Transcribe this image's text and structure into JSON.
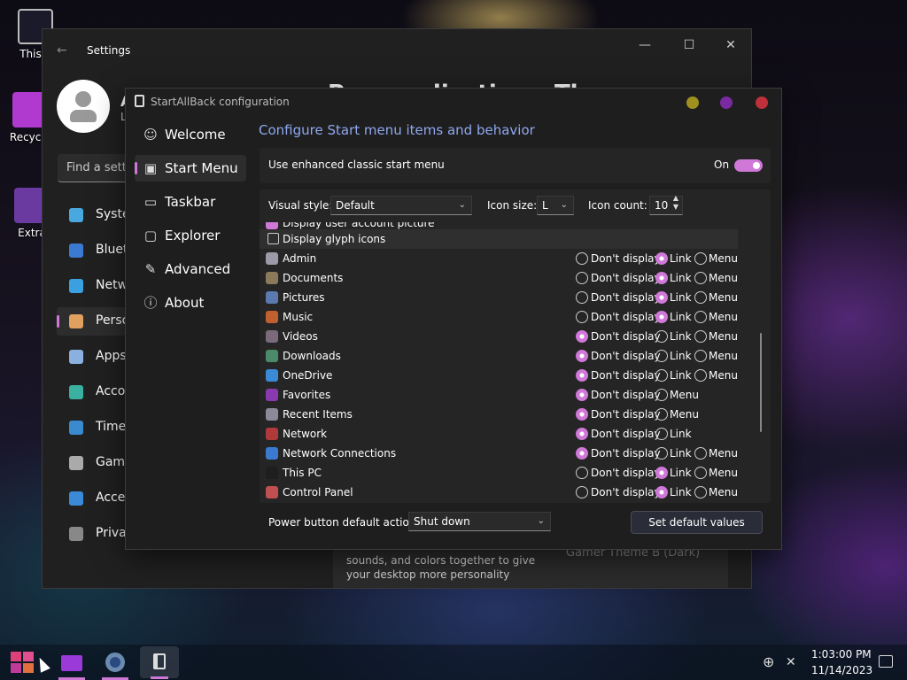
{
  "desktop": {
    "icons": [
      {
        "label": "This P"
      },
      {
        "label": "Recycle"
      },
      {
        "label": "Extra"
      }
    ]
  },
  "settings": {
    "title": "Settings",
    "user_initial": "A",
    "user_sub": "L",
    "search_placeholder": "Find a setti",
    "heading_partial": "Personalization › Themes",
    "nav": [
      {
        "label": "Syster",
        "icon": "monitor-icon"
      },
      {
        "label": "Blueto",
        "icon": "bluetooth-icon"
      },
      {
        "label": "Netwo",
        "icon": "wifi-icon"
      },
      {
        "label": "Perso",
        "icon": "brush-icon"
      },
      {
        "label": "Apps",
        "icon": "apps-icon"
      },
      {
        "label": "Accou",
        "icon": "person-icon"
      },
      {
        "label": "Time",
        "icon": "globe-icon"
      },
      {
        "label": "Gamin",
        "icon": "gamepad-icon"
      },
      {
        "label": "Acces",
        "icon": "accessibility-icon"
      },
      {
        "label": "Privac",
        "icon": "shield-icon"
      }
    ],
    "theme_desc": "sounds, and colors together to give your desktop more personality",
    "theme_name": "Gamer Theme B (Dark)"
  },
  "sab": {
    "title": "StartAllBack configuration",
    "heading": "Configure Start menu items and behavior",
    "nav": [
      {
        "label": "Welcome",
        "icon": "smile-icon"
      },
      {
        "label": "Start Menu",
        "icon": "start-menu-icon"
      },
      {
        "label": "Taskbar",
        "icon": "taskbar-icon"
      },
      {
        "label": "Explorer",
        "icon": "folder-icon"
      },
      {
        "label": "Advanced",
        "icon": "wrench-icon"
      },
      {
        "label": "About",
        "icon": "info-icon"
      }
    ],
    "enhanced_label": "Use enhanced classic start menu",
    "toggle_state": "On",
    "visual_style_label": "Visual style:",
    "visual_style_value": "Default",
    "icon_size_label": "Icon size:",
    "icon_size_value": "L",
    "icon_count_label": "Icon count:",
    "icon_count_value": "10",
    "partial_row": "Display user account picture",
    "glyph_label": "Display glyph icons",
    "items": [
      {
        "name": "Admin",
        "options": [
          "Don't display",
          "Link",
          "Menu"
        ],
        "selected": 1,
        "color": "#9a9aa8"
      },
      {
        "name": "Documents",
        "options": [
          "Don't display",
          "Link",
          "Menu"
        ],
        "selected": 1,
        "color": "#8a7a5a"
      },
      {
        "name": "Pictures",
        "options": [
          "Don't display",
          "Link",
          "Menu"
        ],
        "selected": 1,
        "color": "#5a7ab0"
      },
      {
        "name": "Music",
        "options": [
          "Don't display",
          "Link",
          "Menu"
        ],
        "selected": 1,
        "color": "#c06030"
      },
      {
        "name": "Videos",
        "options": [
          "Don't display",
          "Link",
          "Menu"
        ],
        "selected": 0,
        "color": "#7a6a7a"
      },
      {
        "name": "Downloads",
        "options": [
          "Don't display",
          "Link",
          "Menu"
        ],
        "selected": 0,
        "color": "#4a8a6a"
      },
      {
        "name": "OneDrive",
        "options": [
          "Don't display",
          "Link",
          "Menu"
        ],
        "selected": 0,
        "color": "#3a8ad8"
      },
      {
        "name": "Favorites",
        "options": [
          "Don't display",
          "Menu"
        ],
        "selected": 0,
        "color": "#8a3ab0"
      },
      {
        "name": "Recent Items",
        "options": [
          "Don't display",
          "Menu"
        ],
        "selected": 0,
        "color": "#8a8a9a"
      },
      {
        "name": "Network",
        "options": [
          "Don't display",
          "Link"
        ],
        "selected": 0,
        "color": "#b03a3a"
      },
      {
        "name": "Network Connections",
        "options": [
          "Don't display",
          "Link",
          "Menu"
        ],
        "selected": 0,
        "color": "#3a7ad0"
      },
      {
        "name": "This PC",
        "options": [
          "Don't display",
          "Link",
          "Menu"
        ],
        "selected": 1,
        "color": "#1e1e1e"
      },
      {
        "name": "Control Panel",
        "options": [
          "Don't display",
          "Link",
          "Menu"
        ],
        "selected": 1,
        "color": "#c05050"
      }
    ],
    "power_label": "Power button default action:",
    "power_value": "Shut down",
    "default_button": "Set default values"
  },
  "taskbar": {
    "time": "1:03:00 PM",
    "date": "11/14/2023"
  },
  "colors": {
    "accent": "#cf78d8",
    "link": "#8fa8f0"
  }
}
